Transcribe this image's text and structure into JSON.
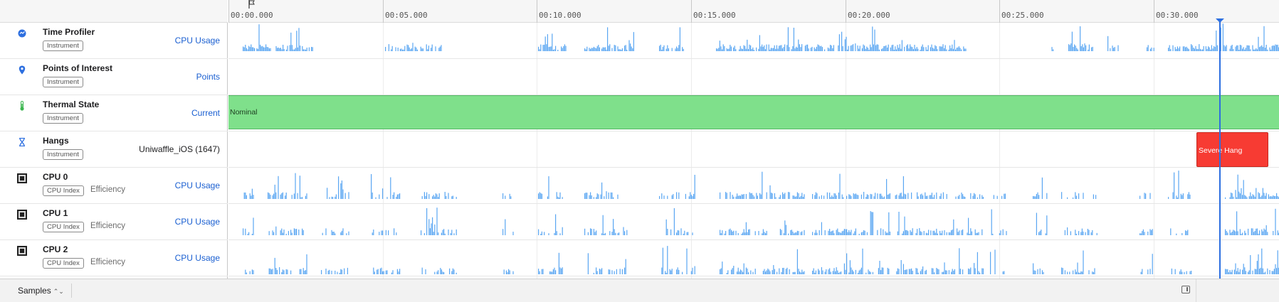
{
  "ruler": {
    "ticks": [
      "00:00.000",
      "00:05.000",
      "00:10.000",
      "00:15.000",
      "00:20.000",
      "00:25.000",
      "00:30.000"
    ]
  },
  "tracks": [
    {
      "name": "Time Profiler",
      "tag": "Instrument",
      "sub": "",
      "right": "CPU Usage",
      "icon": "time-profiler-icon"
    },
    {
      "name": "Points of Interest",
      "tag": "Instrument",
      "sub": "",
      "right": "Points",
      "icon": "points-of-interest-icon"
    },
    {
      "name": "Thermal State",
      "tag": "Instrument",
      "sub": "",
      "right": "Current",
      "icon": "thermometer-icon"
    },
    {
      "name": "Hangs",
      "tag": "Instrument",
      "sub": "",
      "right": "Uniwaffle_iOS (1647)",
      "icon": "hourglass-icon"
    },
    {
      "name": "CPU 0",
      "tag": "CPU Index",
      "sub": "Efficiency",
      "right": "CPU Usage",
      "icon": "cpu-icon"
    },
    {
      "name": "CPU 1",
      "tag": "CPU Index",
      "sub": "Efficiency",
      "right": "CPU Usage",
      "icon": "cpu-icon"
    },
    {
      "name": "CPU 2",
      "tag": "CPU Index",
      "sub": "Efficiency",
      "right": "CPU Usage",
      "icon": "cpu-icon"
    }
  ],
  "lanes": {
    "thermal_state": "Nominal",
    "hang_label": "Severe Hang"
  },
  "bottom": {
    "samples_label": "Samples",
    "samples_chevron": "⌃⌄"
  },
  "colors": {
    "accent": "#2d6fe0",
    "chart_bar": "#5aa6f2",
    "thermal_nominal": "#7fe08b",
    "hang_severe": "#f73b33"
  }
}
